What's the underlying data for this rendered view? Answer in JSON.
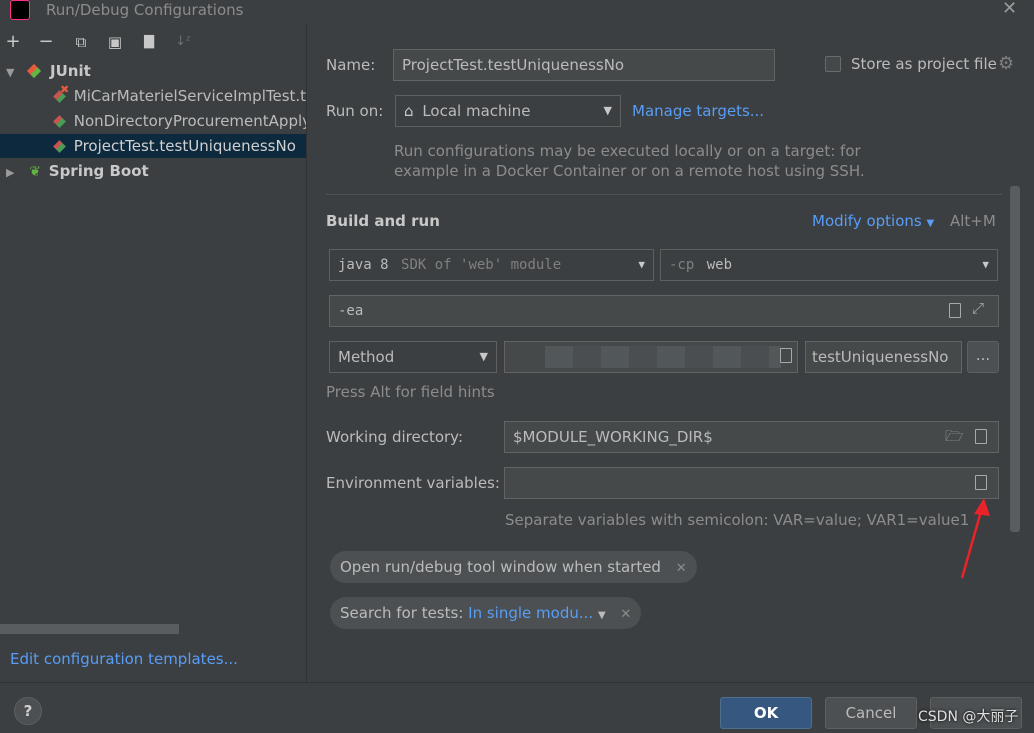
{
  "window": {
    "title": "Run/Debug Configurations"
  },
  "toolbar": {
    "add": "+",
    "remove": "−",
    "copy": "⧉",
    "save": "▣",
    "folder": "▇",
    "sort": "↓ᶻ"
  },
  "tree": {
    "junit_label": "JUnit",
    "items": [
      {
        "label": "MiCarMaterielServiceImplTest.te"
      },
      {
        "label": "NonDirectoryProcurementApply"
      },
      {
        "label": "ProjectTest.testUniquenessNo"
      }
    ],
    "spring_label": "Spring Boot"
  },
  "left_footer": {
    "edit_templates": "Edit configuration templates..."
  },
  "form": {
    "name_label": "Name:",
    "name_value": "ProjectTest.testUniquenessNo",
    "store_label": "Store as project file",
    "run_on_label": "Run on:",
    "run_on_value": "Local machine",
    "manage_targets": "Manage targets...",
    "run_on_hint_1": "Run configurations may be executed locally or on a target: for",
    "run_on_hint_2": "example in a Docker Container or on a remote host using SSH.",
    "build_and_run": "Build and run",
    "modify_options": "Modify options",
    "modify_shortcut": "Alt+M",
    "sdk_main": "java 8",
    "sdk_sub": "SDK of 'web' module",
    "cp_flag": "-cp",
    "cp_value": "web",
    "vm_options": "-ea",
    "test_kind": "Method",
    "method_value": "testUniquenessNo",
    "browse": "...",
    "field_hints": "Press Alt for field hints",
    "working_dir_label": "Working directory:",
    "working_dir_value": "$MODULE_WORKING_DIR$",
    "env_label": "Environment variables:",
    "env_hint": "Separate variables with semicolon: VAR=value; VAR1=value1",
    "chip_open_tool": "Open run/debug tool window when started",
    "chip_search_prefix": "Search for tests:",
    "chip_search_value": "In single modu..."
  },
  "footer": {
    "help": "?",
    "ok": "OK",
    "cancel": "Cancel",
    "watermark": "CSDN @大丽子"
  },
  "colors": {
    "accent_link": "#589df6",
    "ok_button": "#365880",
    "annotation_arrow": "#e8232a"
  }
}
